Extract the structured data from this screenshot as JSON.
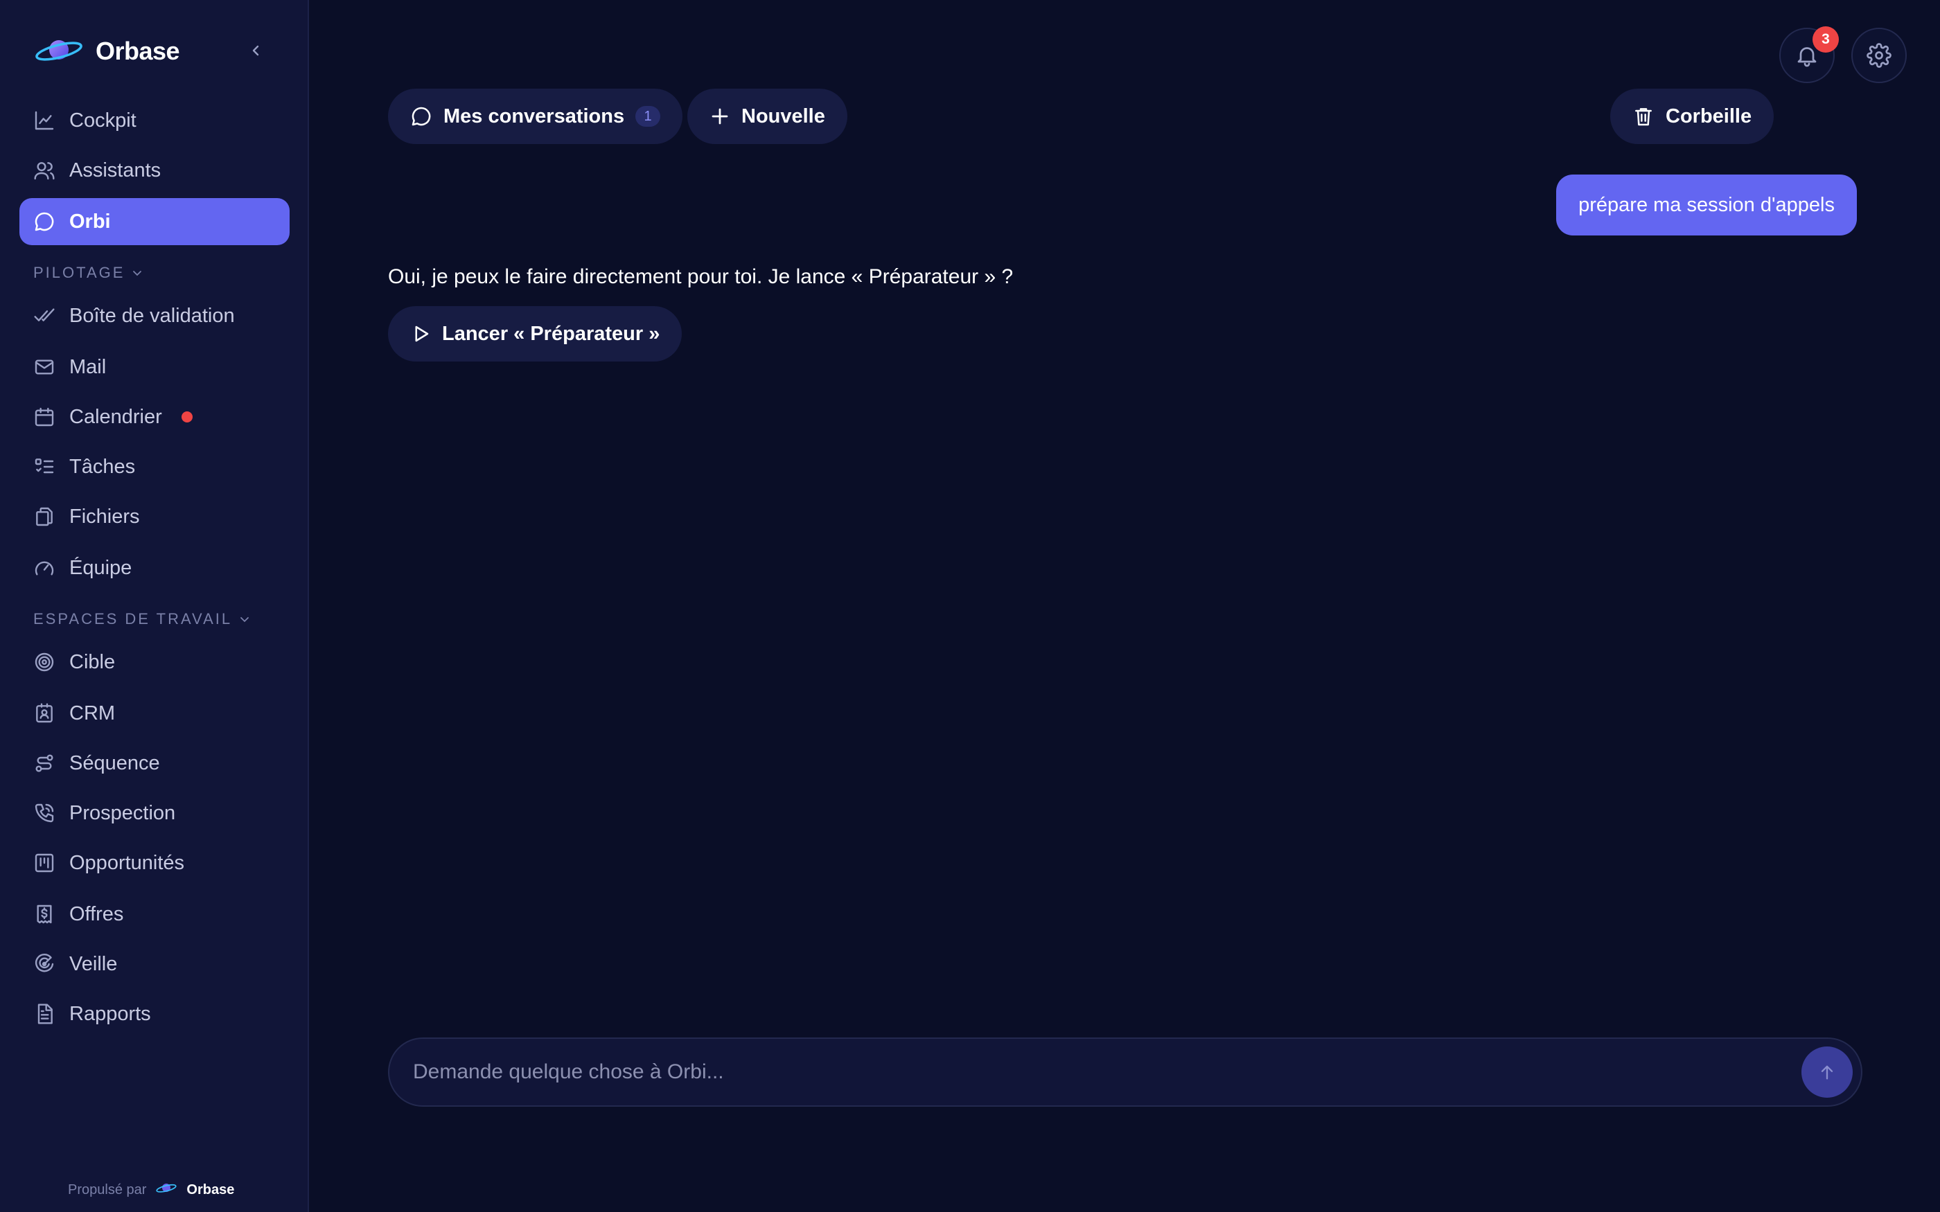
{
  "app": {
    "name": "Orbase"
  },
  "colors": {
    "accent": "#6366f1",
    "background": "#0a0e27",
    "sidebar": "#111538",
    "alert": "#ef4444"
  },
  "sidebar": {
    "top_items": [
      {
        "label": "Cockpit",
        "icon": "chart-line-icon"
      },
      {
        "label": "Assistants",
        "icon": "users-icon"
      },
      {
        "label": "Orbi",
        "icon": "chat-bubble-icon",
        "active": true
      }
    ],
    "sections": [
      {
        "title": "PILOTAGE",
        "items": [
          {
            "label": "Boîte de validation",
            "icon": "double-check-icon"
          },
          {
            "label": "Mail",
            "icon": "mail-icon"
          },
          {
            "label": "Calendrier",
            "icon": "calendar-icon",
            "notification_dot": true
          },
          {
            "label": "Tâches",
            "icon": "task-list-icon"
          },
          {
            "label": "Fichiers",
            "icon": "files-icon"
          },
          {
            "label": "Équipe",
            "icon": "gauge-icon"
          }
        ]
      },
      {
        "title": "ESPACES DE TRAVAIL",
        "items": [
          {
            "label": "Cible",
            "icon": "target-icon"
          },
          {
            "label": "CRM",
            "icon": "contact-card-icon"
          },
          {
            "label": "Séquence",
            "icon": "workflow-icon"
          },
          {
            "label": "Prospection",
            "icon": "phone-icon"
          },
          {
            "label": "Opportunités",
            "icon": "kanban-icon"
          },
          {
            "label": "Offres",
            "icon": "receipt-dollar-icon"
          },
          {
            "label": "Veille",
            "icon": "radar-icon"
          },
          {
            "label": "Rapports",
            "icon": "report-icon"
          }
        ]
      }
    ],
    "footer": {
      "prefix": "Propulsé par",
      "brand": "Orbase"
    }
  },
  "header": {
    "notifications_count": "3"
  },
  "toolbar": {
    "conversations_label": "Mes conversations",
    "conversations_count": "1",
    "new_label": "Nouvelle",
    "trash_label": "Corbeille"
  },
  "chat": {
    "user_message": "prépare ma session d'appels",
    "assistant_message": "Oui, je peux le faire directement pour toi. Je lance « Préparateur » ?",
    "action_label": "Lancer « Préparateur »"
  },
  "composer": {
    "placeholder": "Demande quelque chose à Orbi..."
  }
}
